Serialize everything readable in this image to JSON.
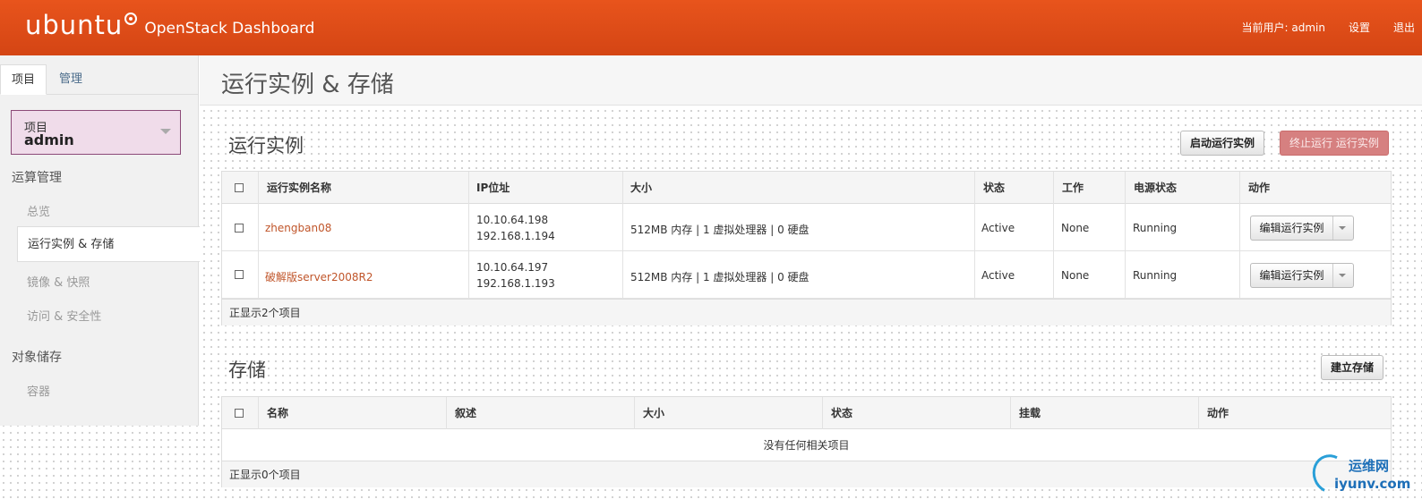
{
  "header": {
    "logo": "ubuntu",
    "product": "OpenStack Dashboard",
    "current_user": "当前用户: admin",
    "settings": "设置",
    "logout": "退出",
    "brand_color": "#e14e19"
  },
  "sidebar": {
    "tabs": [
      "项目",
      "管理"
    ],
    "project_label": "项目",
    "project_value": "admin",
    "compute_section": "运算管理",
    "compute_items": [
      "总览",
      "运行实例 & 存储",
      "镜像 & 快照",
      "访问 & 安全性"
    ],
    "storage_section": "对象储存",
    "storage_items": [
      "容器"
    ]
  },
  "page": {
    "title": "运行实例 & 存储"
  },
  "instances": {
    "title": "运行实例",
    "launch_button": "启动运行实例",
    "terminate_button": "终止运行 运行实例",
    "columns": [
      "运行实例名称",
      "IP位址",
      "大小",
      "状态",
      "工作",
      "电源状态",
      "动作"
    ],
    "rows": [
      {
        "name": "zhengban08",
        "ip1": "10.10.64.198",
        "ip2": "192.168.1.194",
        "size": "512MB 内存 | 1 虚拟处理器 | 0 硬盘",
        "status": "Active",
        "task": "None",
        "power": "Running",
        "action": "编辑运行实例"
      },
      {
        "name": "破解版server2008R2",
        "ip1": "10.10.64.197",
        "ip2": "192.168.1.193",
        "size": "512MB 内存 | 1 虚拟处理器 | 0 硬盘",
        "status": "Active",
        "task": "None",
        "power": "Running",
        "action": "编辑运行实例"
      }
    ],
    "footer": "正显示2个项目"
  },
  "volumes": {
    "title": "存储",
    "create_button": "建立存储",
    "columns": [
      "名称",
      "叙述",
      "大小",
      "状态",
      "挂载",
      "动作"
    ],
    "empty": "没有任何相关项目",
    "footer": "正显示0个项目"
  },
  "watermark": {
    "top": "运维网",
    "bottom": "iyunv.com"
  }
}
